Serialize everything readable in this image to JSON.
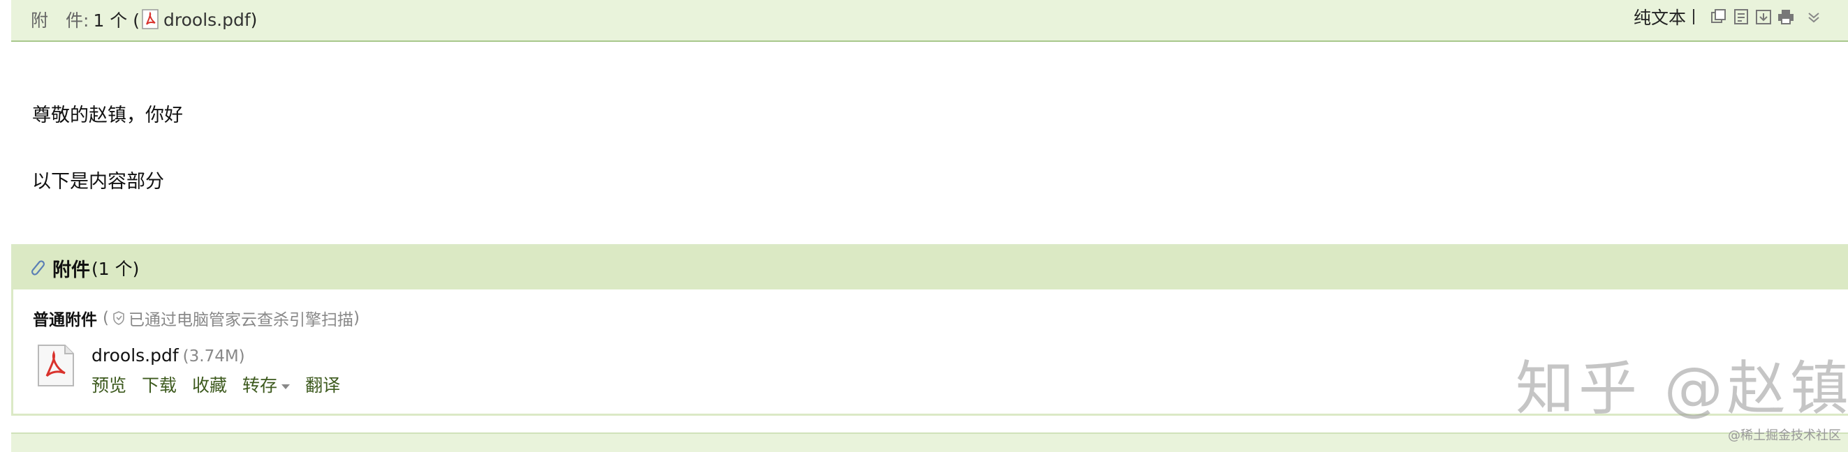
{
  "header": {
    "cut_text": "",
    "attachment_label": "附　件:",
    "attachment_count": "1 个 (",
    "attachment_file": "drools.pdf",
    "attachment_close": ")",
    "plain_text_label": "纯文本",
    "tool_icons": [
      "new-window-icon",
      "note-icon",
      "download-icon",
      "print-icon",
      "expand-icon"
    ]
  },
  "body": {
    "greeting": "尊敬的赵镇，你好",
    "content": "以下是内容部分"
  },
  "attachments_panel": {
    "title": "附件",
    "count": "(1 个)",
    "normal_label": "普通附件",
    "scan_open": "(",
    "scan_note": "已通过电脑管家云查杀引擎扫描",
    "scan_close": ")",
    "file": {
      "name": "drools.pdf",
      "size": "(3.74M)"
    },
    "actions": {
      "preview": "预览",
      "download": "下载",
      "favorite": "收藏",
      "save_to": "转存",
      "translate": "翻译"
    }
  },
  "watermark": {
    "text": "知乎 @赵镇",
    "community": "@稀土掘金技术社区"
  },
  "colors": {
    "header_bg": "#e9f3db",
    "panel_title_bg": "#dbe9c4",
    "action_link": "#3d5a1e",
    "pdf_red": "#d9322c"
  }
}
